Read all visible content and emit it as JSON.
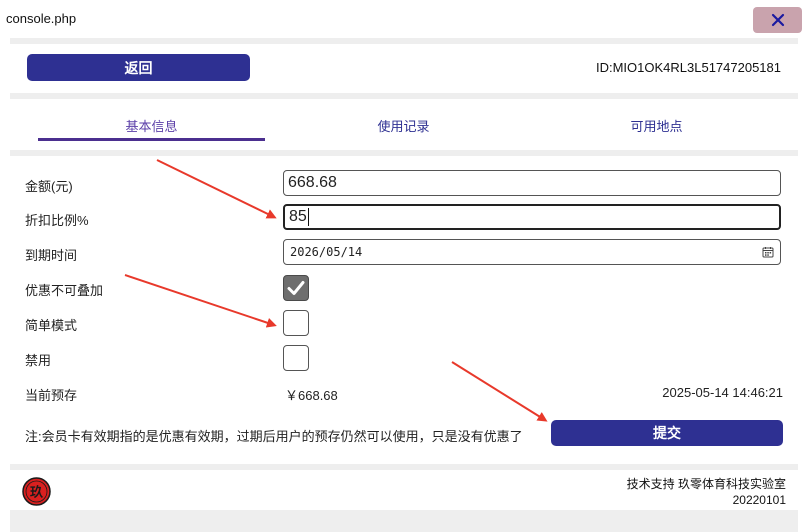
{
  "window": {
    "title": "console.php",
    "close_icon": "close-x-icon"
  },
  "header": {
    "back_label": "返回",
    "card_id": "ID:MIO1OK4RL3L51747205181"
  },
  "tabs": [
    {
      "label": "基本信息",
      "active": true
    },
    {
      "label": "使用记录",
      "active": false
    },
    {
      "label": "可用地点",
      "active": false
    }
  ],
  "form": {
    "amount": {
      "label": "金额(元)",
      "value": "668.68"
    },
    "discount": {
      "label": "折扣比例%",
      "value": "85"
    },
    "expiry": {
      "label": "到期时间",
      "value": "2026/05/14",
      "icon": "calendar-icon"
    },
    "no_stacking": {
      "label": "优惠不可叠加",
      "checked": true
    },
    "simple_mode": {
      "label": "简单模式",
      "checked": false
    },
    "disabled": {
      "label": "禁用",
      "checked": false
    }
  },
  "balance": {
    "label": "当前预存",
    "value": "￥668.68",
    "timestamp": "2025-05-14 14:46:21"
  },
  "note": "注:会员卡有效期指的是优惠有效期，过期后用户的预存仍然可以使用，只是没有优惠了",
  "submit_label": "提交",
  "footer": {
    "support": "技术支持 玖零体育科技实验室",
    "version": "20220101",
    "logo_char": "玖"
  },
  "colors": {
    "primary": "#2e3092",
    "tab_underline": "#4b2f8f",
    "close_bg": "#c9a3ad",
    "arrow": "#e8392b",
    "logo_red": "#d9201f"
  }
}
